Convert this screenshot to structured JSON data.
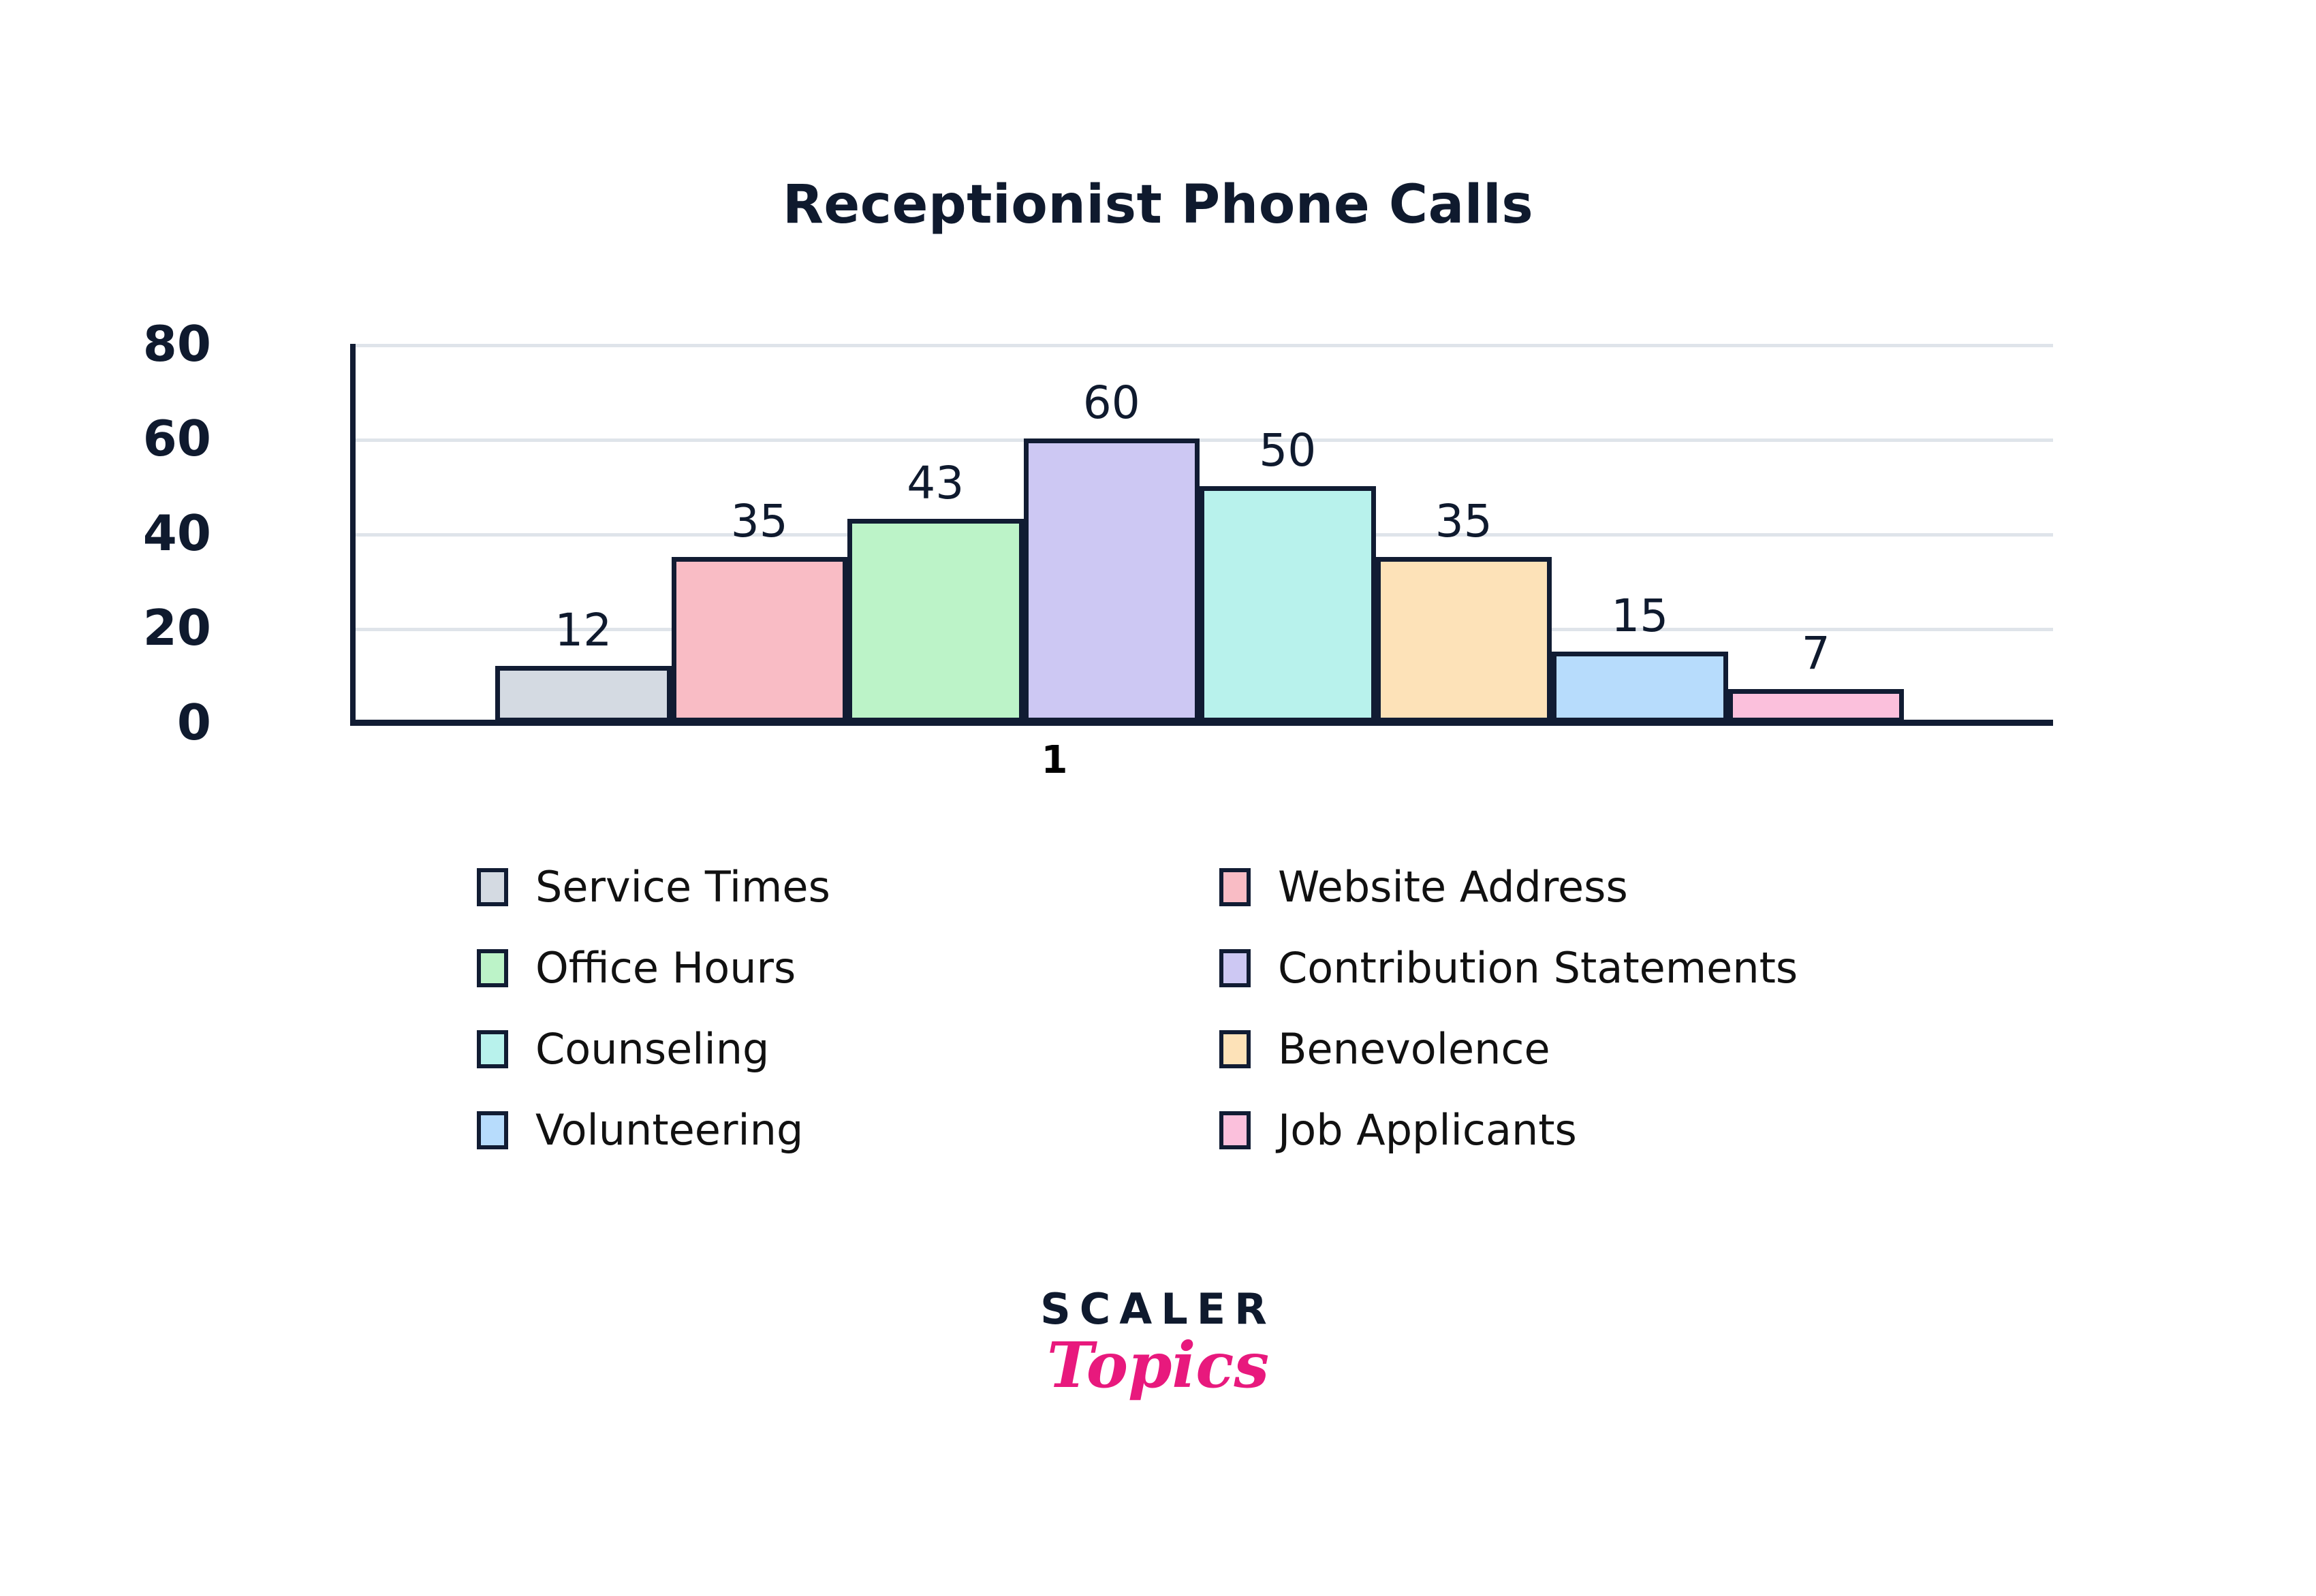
{
  "chart_data": {
    "type": "bar",
    "title": "Receptionist Phone Calls",
    "xlabel": "1",
    "ylabel": "",
    "categories": [
      "Service Times",
      "Website Address",
      "Office Hours",
      "Contribution Statements",
      "Counseling",
      "Benevolence",
      "Volunteering",
      "Job Applicants"
    ],
    "values": [
      12,
      35,
      43,
      60,
      50,
      35,
      15,
      7
    ],
    "value_labels": [
      "12",
      "35",
      "43",
      "60",
      "50",
      "35",
      "15",
      "7"
    ],
    "colors": [
      "#d4dae2",
      "#f9bcc5",
      "#bcf3c8",
      "#cdc8f3",
      "#b8f2ec",
      "#fde2b8",
      "#b7dcfc",
      "#fbc0dc"
    ],
    "bar_edge_color": "#111c33",
    "ylim": [
      0,
      80
    ],
    "yticks": [
      0,
      20,
      40,
      60,
      80
    ],
    "ytick_labels": [
      "0",
      "20",
      "40",
      "60",
      "80"
    ],
    "xticks": [
      "1"
    ],
    "grid": true,
    "grid_color": "#dfe4ea",
    "legend_position": "below-chart",
    "legend_columns": 2,
    "axis_color": "#111c33",
    "title_color": "#0f1a2e",
    "background": "#ffffff"
  },
  "title": {
    "text": "Receptionist Phone Calls"
  },
  "yaxis": {
    "ticks": [
      {
        "label": "80",
        "value": 80
      },
      {
        "label": "60",
        "value": 60
      },
      {
        "label": "40",
        "value": 40
      },
      {
        "label": "20",
        "value": 20
      },
      {
        "label": "0",
        "value": 0
      }
    ]
  },
  "xaxis": {
    "label": "1"
  },
  "bars": [
    {
      "label": "Service Times",
      "value": 12,
      "value_label": "12",
      "color": "#d4dae2"
    },
    {
      "label": "Website Address",
      "value": 35,
      "value_label": "35",
      "color": "#f9bcc5"
    },
    {
      "label": "Office Hours",
      "value": 43,
      "value_label": "43",
      "color": "#bcf3c8"
    },
    {
      "label": "Contribution Statements",
      "value": 60,
      "value_label": "60",
      "color": "#cdc8f3"
    },
    {
      "label": "Counseling",
      "value": 50,
      "value_label": "50",
      "color": "#b8f2ec"
    },
    {
      "label": "Benevolence",
      "value": 35,
      "value_label": "35",
      "color": "#fde2b8"
    },
    {
      "label": "Volunteering",
      "value": 15,
      "value_label": "15",
      "color": "#b7dcfc"
    },
    {
      "label": "Job Applicants",
      "value": 7,
      "value_label": "7",
      "color": "#fbc0dc"
    }
  ],
  "legend": {
    "items": [
      {
        "label": "Service Times",
        "color": "#d4dae2"
      },
      {
        "label": "Website Address",
        "color": "#f9bcc5"
      },
      {
        "label": "Office Hours",
        "color": "#bcf3c8"
      },
      {
        "label": "Contribution Statements",
        "color": "#cdc8f3"
      },
      {
        "label": "Counseling",
        "color": "#b8f2ec"
      },
      {
        "label": "Benevolence",
        "color": "#fde2b8"
      },
      {
        "label": "Volunteering",
        "color": "#b7dcfc"
      },
      {
        "label": "Job Applicants",
        "color": "#fbc0dc"
      }
    ]
  },
  "logo": {
    "primary": "SCALER",
    "secondary": "Topics",
    "primary_color": "#0f1a2e",
    "secondary_color": "#e8197d"
  }
}
